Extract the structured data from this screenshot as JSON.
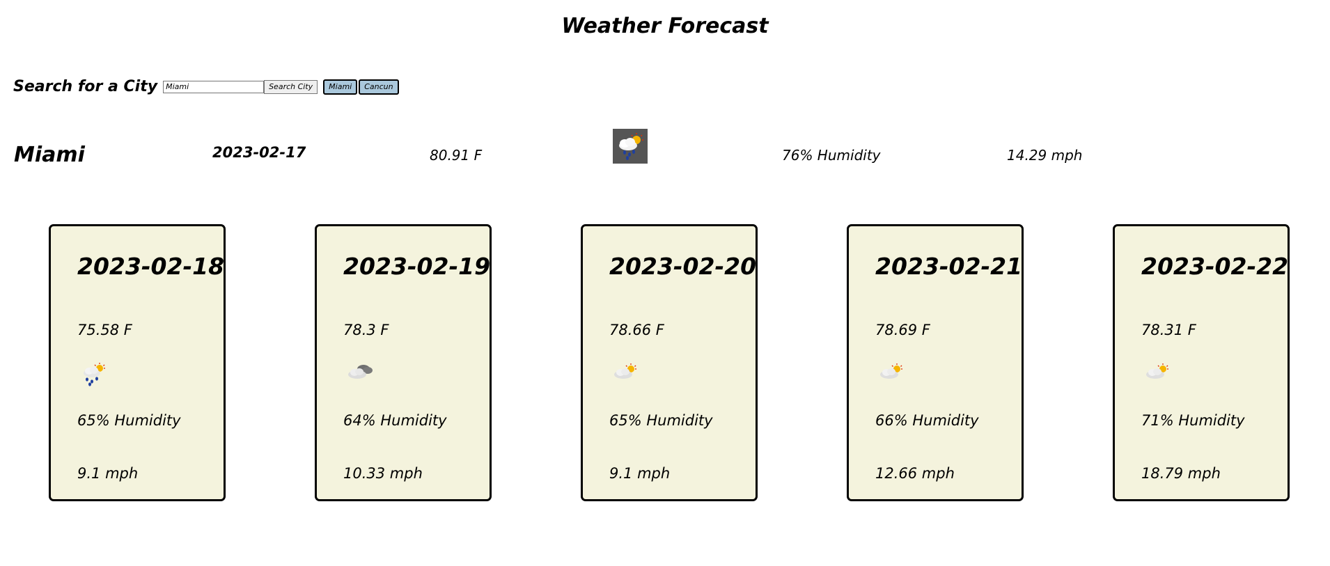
{
  "page": {
    "title": "Weather Forecast"
  },
  "search": {
    "label": "Search for a City",
    "input_value": "Miami",
    "button_label": "Search City",
    "history": [
      "Miami",
      "Cancun"
    ]
  },
  "current": {
    "city": "Miami",
    "date": "2023-02-17",
    "temp": "80.91 F",
    "icon": "rain-sun-icon",
    "humidity": "76% Humidity",
    "wind": "14.29 mph"
  },
  "forecast": [
    {
      "date": "2023-02-18",
      "temp": "75.58 F",
      "icon": "rain-sun-icon",
      "humidity": "65% Humidity",
      "wind": "9.1 mph"
    },
    {
      "date": "2023-02-19",
      "temp": "78.3 F",
      "icon": "cloudy-icon",
      "humidity": "64% Humidity",
      "wind": "10.33 mph"
    },
    {
      "date": "2023-02-20",
      "temp": "78.66 F",
      "icon": "partly-cloudy-icon",
      "humidity": "65% Humidity",
      "wind": "9.1 mph"
    },
    {
      "date": "2023-02-21",
      "temp": "78.69 F",
      "icon": "partly-cloudy-icon",
      "humidity": "66% Humidity",
      "wind": "12.66 mph"
    },
    {
      "date": "2023-02-22",
      "temp": "78.31 F",
      "icon": "partly-cloudy-icon",
      "humidity": "71% Humidity",
      "wind": "18.79 mph"
    }
  ],
  "colors": {
    "card_background": "#f4f3dd",
    "history_button": "#aac8dc",
    "current_icon_background": "#555555"
  }
}
